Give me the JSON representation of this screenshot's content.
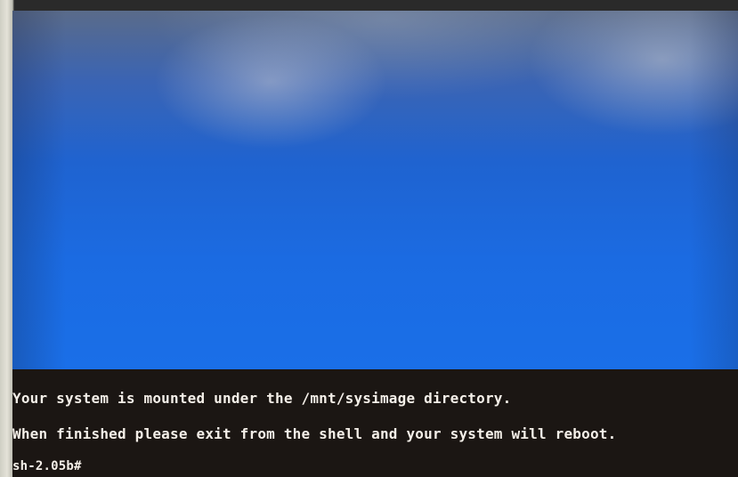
{
  "console": {
    "lines": [
      "Your system is mounted under the /mnt/sysimage directory.",
      "When finished please exit from the shell and your system will reboot.",
      "sh-2.05b#"
    ]
  },
  "colors": {
    "desktop_blue": "#1a6fe8",
    "console_background": "#1b1613",
    "console_text": "#f4efe8"
  }
}
